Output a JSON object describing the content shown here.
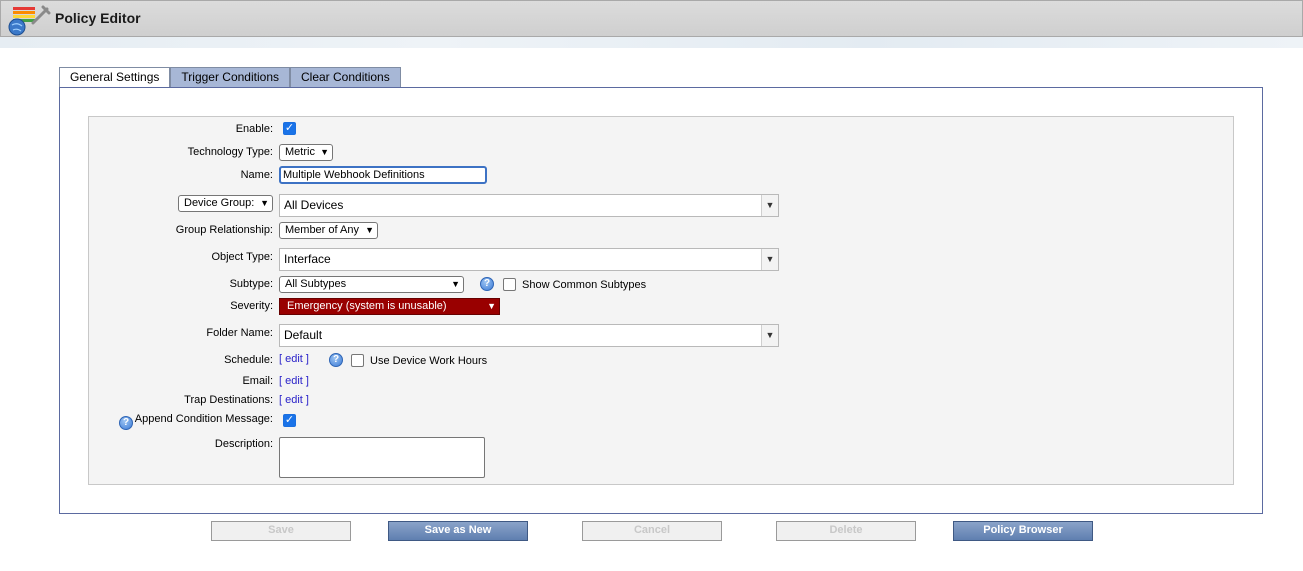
{
  "window": {
    "title": "Policy Editor",
    "app_icon": "policy-editor-icon"
  },
  "tabs": [
    {
      "label": "General Settings",
      "active": true
    },
    {
      "label": "Trigger Conditions",
      "active": false
    },
    {
      "label": "Clear Conditions",
      "active": false
    }
  ],
  "form": {
    "enable": {
      "label": "Enable:",
      "checked": true
    },
    "technology_type": {
      "label": "Technology Type:",
      "value": "Metric"
    },
    "name": {
      "label": "Name:",
      "value": "Multiple Webhook Definitions"
    },
    "device_group": {
      "selector_value": "Device Group:",
      "value": "All Devices"
    },
    "group_relationship": {
      "label": "Group Relationship:",
      "value": "Member of Any"
    },
    "object_type": {
      "label": "Object Type:",
      "value": "Interface"
    },
    "subtype": {
      "label": "Subtype:",
      "value": "All Subtypes",
      "show_common_label": "Show Common Subtypes",
      "show_common_checked": false
    },
    "severity": {
      "label": "Severity:",
      "value": "Emergency (system is unusable)",
      "color": "#990000"
    },
    "folder_name": {
      "label": "Folder Name:",
      "value": "Default"
    },
    "schedule": {
      "label": "Schedule:",
      "link": "[ edit ]",
      "work_hours_label": "Use Device Work Hours",
      "work_hours_checked": false
    },
    "email": {
      "label": "Email:",
      "link": "[ edit ]"
    },
    "trap_destinations": {
      "label": "Trap Destinations:",
      "link": "[ edit ]"
    },
    "append_condition_message": {
      "label": "Append Condition Message:",
      "checked": true
    },
    "description": {
      "label": "Description:",
      "value": ""
    }
  },
  "buttons": {
    "save": "Save",
    "save_as_new": "Save as New",
    "cancel": "Cancel",
    "delete": "Delete",
    "policy_browser": "Policy Browser"
  },
  "colors": {
    "accent_check": "#1a73e8",
    "tab_inactive": "#a7b7d6",
    "button_enabled": "#6f8dbd",
    "severity_bg": "#990000"
  }
}
